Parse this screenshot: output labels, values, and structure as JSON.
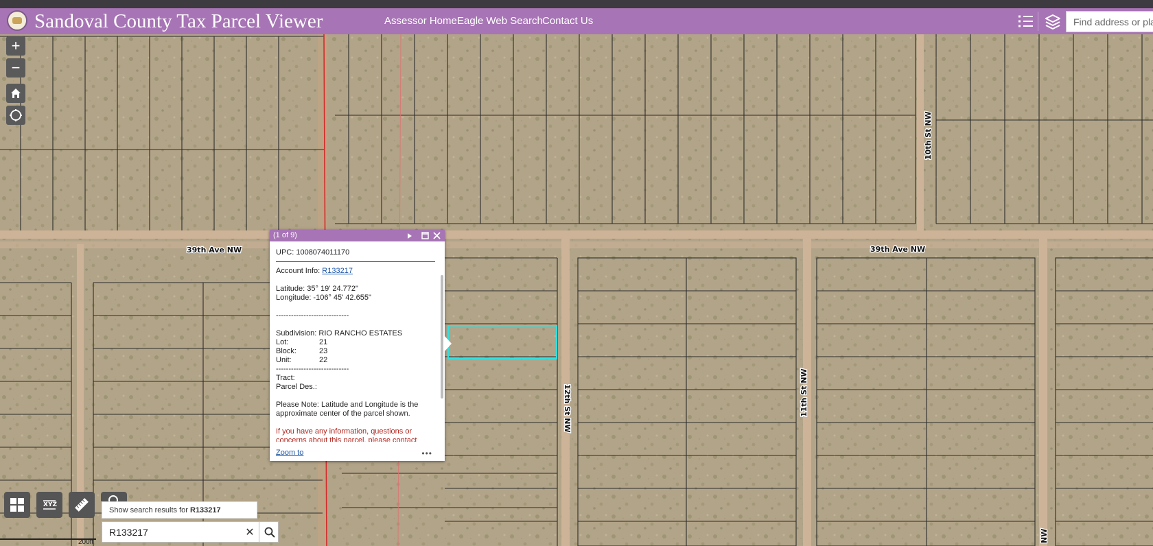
{
  "header": {
    "title": "Sandoval County Tax Parcel Viewer",
    "nav": [
      "Assessor Home",
      "Eagle Web Search",
      "Contact Us"
    ],
    "search_placeholder": "Find address or place"
  },
  "map": {
    "street_labels": [
      "39th Ave NW",
      "39th Ave NW",
      "10th St NW",
      "12th St NW",
      "11th St NW",
      "NW"
    ],
    "scale_label": "200ft",
    "highlight_color": "#33e0e0",
    "header_color": "#a774b5"
  },
  "popup": {
    "counter": "(1 of 9)",
    "upc": "UPC: 1008074011170",
    "account_label": "Account Info:",
    "account_value": "R133217",
    "latitude": "Latitude: 35° 19' 24.772\"",
    "longitude": "Longitude: -106° 45' 42.655\"",
    "dashes": "-----------------------------",
    "subdivision": "Subdivision: RIO RANCHO ESTATES",
    "lot_label": "Lot:",
    "lot_value": "21",
    "block_label": "Block:",
    "block_value": "23",
    "unit_label": "Unit:",
    "unit_value": "22",
    "tract": "Tract:",
    "parcel_des": "Parcel Des.:",
    "note": "Please Note: Latitude and Longitude is the approximate center of the parcel shown.",
    "contact": "If you have any information, questions or concerns about this parcel, please contact",
    "zoom": "Zoom to"
  },
  "search": {
    "suggestion_prefix": "Show search results for ",
    "suggestion_term": "R133217",
    "value": "R133217"
  }
}
